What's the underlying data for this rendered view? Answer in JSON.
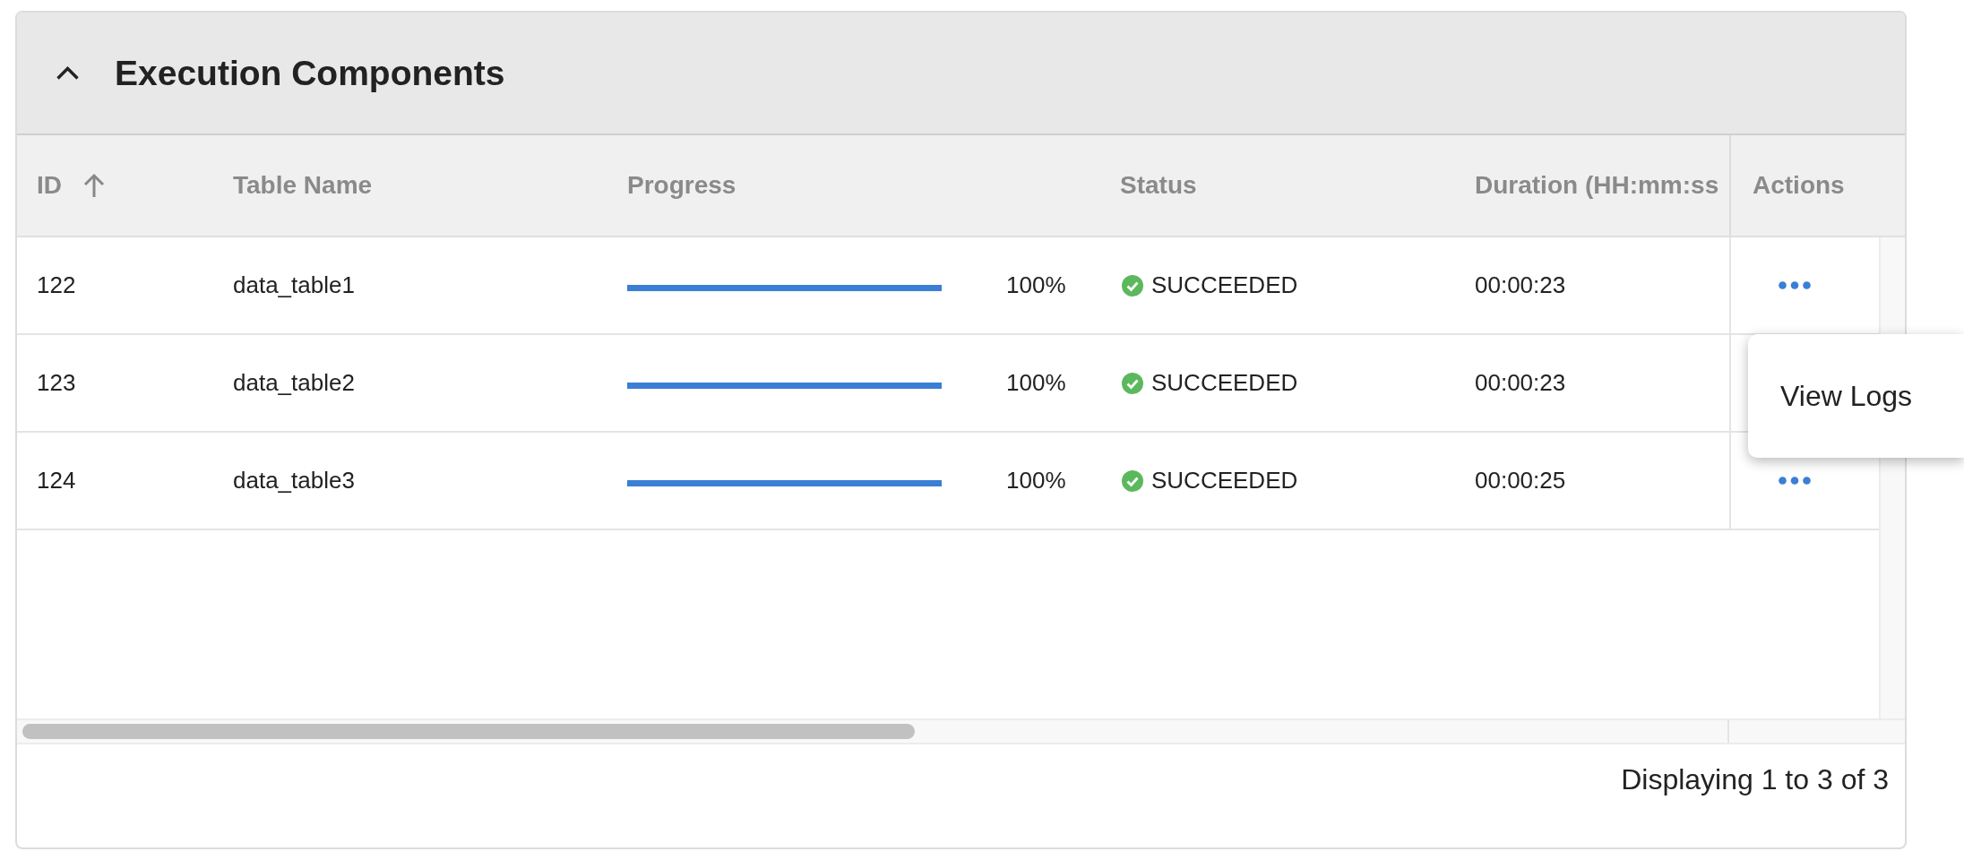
{
  "panel": {
    "title": "Execution Components",
    "expanded": true
  },
  "table": {
    "columns": [
      {
        "label": "ID",
        "sorted": true
      },
      {
        "label": "Table Name",
        "sorted": false
      },
      {
        "label": "Progress",
        "sorted": false
      },
      {
        "label": "Status",
        "sorted": false
      },
      {
        "label": "Duration (HH:mm:ss",
        "sorted": false
      },
      {
        "label": "Actions",
        "sorted": false
      }
    ],
    "rows": [
      {
        "id": "122",
        "table_name": "data_table1",
        "progress": {
          "level": 1,
          "text": "100%"
        },
        "status": {
          "kind": "succeeded",
          "label": "SUCCEEDED"
        },
        "duration": "00:00:23",
        "menu_open": false
      },
      {
        "id": "123",
        "table_name": "data_table2",
        "progress": {
          "level": 1,
          "text": "100%"
        },
        "status": {
          "kind": "succeeded",
          "label": "SUCCEEDED"
        },
        "duration": "00:00:23",
        "menu_open": true
      },
      {
        "id": "124",
        "table_name": "data_table3",
        "progress": {
          "level": 1,
          "text": "100%"
        },
        "status": {
          "kind": "succeeded",
          "label": "SUCCEEDED"
        },
        "duration": "00:00:25",
        "menu_open": false
      }
    ]
  },
  "action_menu": {
    "items": [
      {
        "label": "View Logs"
      }
    ]
  },
  "footer": {
    "summary": "Displaying 1 to 3 of 3"
  }
}
